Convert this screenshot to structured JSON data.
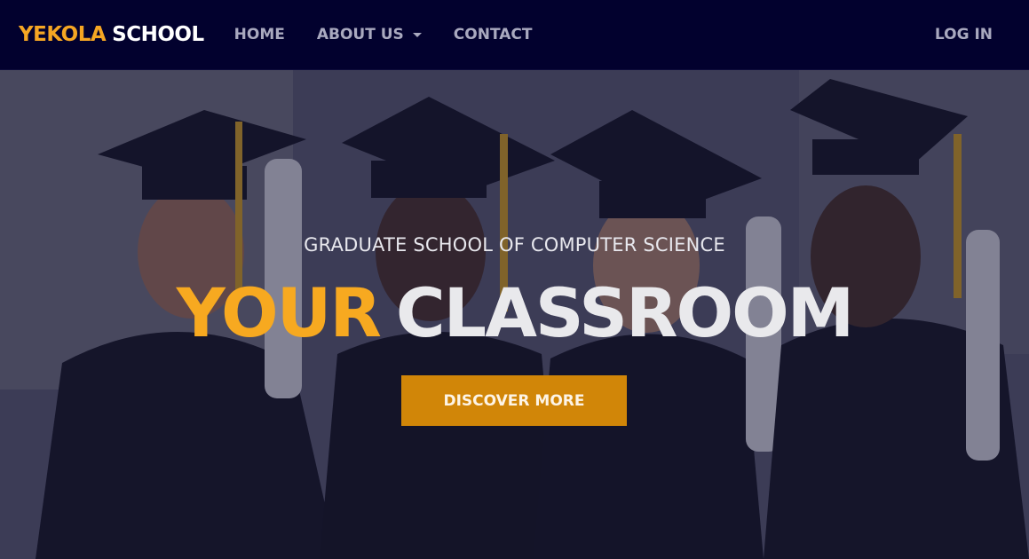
{
  "navbar": {
    "brand_part1": "YEKOLA",
    "brand_part2": "SCHOOL",
    "links": [
      {
        "label": "HOME"
      },
      {
        "label": "ABOUT US"
      },
      {
        "label": "CONTACT"
      }
    ],
    "login_label": "LOG IN"
  },
  "hero": {
    "subtitle": "GRADUATE SCHOOL OF COMPUTER SCIENCE",
    "headline_part1": "YOUR",
    "headline_part2": "CLASSROOM",
    "cta_label": "DISCOVER MORE",
    "image_icon": "graduates-photo"
  },
  "colors": {
    "navbar_bg": "#02012e",
    "brand_accent": "#f5a623",
    "cta_bg": "#d18608",
    "headline_accent": "#f7a920"
  }
}
